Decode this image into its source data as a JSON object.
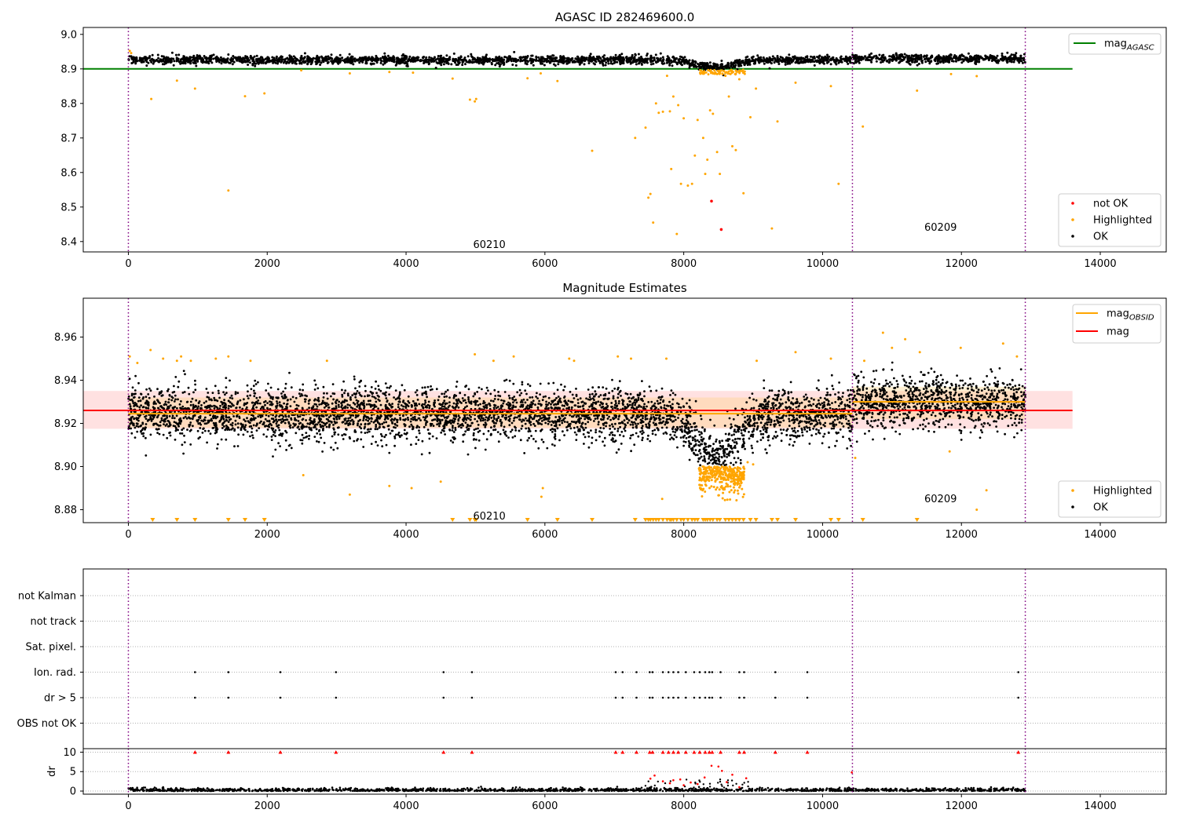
{
  "chart_data": [
    {
      "type": "scatter",
      "title": "AGASC ID 282469600.0",
      "xlim": [
        -650,
        14950
      ],
      "ylim": [
        8.37,
        9.02
      ],
      "x_ticks": [
        0,
        2000,
        4000,
        6000,
        8000,
        10000,
        12000,
        14000
      ],
      "y_ticks": [
        8.4,
        8.5,
        8.6,
        8.7,
        8.8,
        8.9,
        9.0
      ],
      "y_decimals": 1,
      "obsid_boundaries": [
        0,
        10430,
        12920
      ],
      "obsid_labels": [
        {
          "text": "60210",
          "x": 5200,
          "y": 8.39
        },
        {
          "text": "60209",
          "x": 11700,
          "y": 8.44
        }
      ],
      "hlines": [
        {
          "name": "mag_AGASC",
          "y": 8.9,
          "x0": -650,
          "x1": 13600,
          "color": "#008000"
        }
      ],
      "series_summary": {
        "OK": {
          "color": "#000000",
          "base_level": 8.926,
          "dip_center": 8450,
          "dip_depth": 0.021
        },
        "Highlighted": {
          "color": "#FFA500"
        },
        "not OK": {
          "color": "#FF0000"
        }
      },
      "highlighted_points": [
        [
          20,
          8.952
        ],
        [
          40,
          8.946
        ],
        [
          330,
          8.813
        ],
        [
          700,
          8.866
        ],
        [
          960,
          8.843
        ],
        [
          1440,
          8.548
        ],
        [
          1680,
          8.821
        ],
        [
          1960,
          8.829
        ],
        [
          2490,
          8.896
        ],
        [
          3190,
          8.887
        ],
        [
          3760,
          8.891
        ],
        [
          4100,
          8.889
        ],
        [
          4670,
          8.872
        ],
        [
          4920,
          8.811
        ],
        [
          4990,
          8.806
        ],
        [
          5010,
          8.813
        ],
        [
          5750,
          8.873
        ],
        [
          5940,
          8.887
        ],
        [
          6180,
          8.865
        ],
        [
          6680,
          8.663
        ],
        [
          7300,
          8.7
        ],
        [
          7450,
          8.73
        ],
        [
          7490,
          8.527
        ],
        [
          7520,
          8.538
        ],
        [
          7560,
          8.455
        ],
        [
          7600,
          8.8
        ],
        [
          7640,
          8.773
        ],
        [
          7700,
          8.776
        ],
        [
          7760,
          8.88
        ],
        [
          7800,
          8.777
        ],
        [
          7820,
          8.61
        ],
        [
          7850,
          8.82
        ],
        [
          7900,
          8.422
        ],
        [
          7920,
          8.795
        ],
        [
          7960,
          8.567
        ],
        [
          8000,
          8.757
        ],
        [
          8060,
          8.562
        ],
        [
          8120,
          8.567
        ],
        [
          8160,
          8.649
        ],
        [
          8200,
          8.752
        ],
        [
          8240,
          8.886
        ],
        [
          8280,
          8.7
        ],
        [
          8310,
          8.596
        ],
        [
          8340,
          8.637
        ],
        [
          8380,
          8.78
        ],
        [
          8420,
          8.77
        ],
        [
          8480,
          8.659
        ],
        [
          8520,
          8.596
        ],
        [
          8560,
          8.885
        ],
        [
          8600,
          8.88
        ],
        [
          8650,
          8.82
        ],
        [
          8700,
          8.676
        ],
        [
          8750,
          8.665
        ],
        [
          8800,
          8.87
        ],
        [
          8860,
          8.54
        ],
        [
          8960,
          8.76
        ],
        [
          9040,
          8.843
        ],
        [
          9270,
          8.438
        ],
        [
          9350,
          8.748
        ],
        [
          9610,
          8.86
        ],
        [
          10120,
          8.85
        ],
        [
          10230,
          8.567
        ],
        [
          10580,
          8.733
        ],
        [
          11360,
          8.837
        ],
        [
          11850,
          8.885
        ],
        [
          12220,
          8.879
        ]
      ],
      "not_ok_points": [
        [
          8400,
          8.517
        ],
        [
          8540,
          8.435
        ]
      ],
      "legend": [
        {
          "label": "mag_AGASC",
          "kind": "line",
          "color": "#008000",
          "position": "top-right"
        },
        {
          "label": "not OK",
          "kind": "dot",
          "color": "#FF0000",
          "position": "bottom-right"
        },
        {
          "label": "Highlighted",
          "kind": "dot",
          "color": "#FFA500",
          "position": "bottom-right"
        },
        {
          "label": "OK",
          "kind": "dot",
          "color": "#000000",
          "position": "bottom-right"
        }
      ]
    },
    {
      "type": "scatter",
      "title": "Magnitude Estimates",
      "xlim": [
        -650,
        14950
      ],
      "ylim": [
        8.874,
        8.978
      ],
      "x_ticks": [
        0,
        2000,
        4000,
        6000,
        8000,
        10000,
        12000,
        14000
      ],
      "y_ticks": [
        8.88,
        8.9,
        8.92,
        8.94,
        8.96
      ],
      "y_decimals": 2,
      "obsid_boundaries": [
        0,
        10430,
        12920
      ],
      "obsid_labels": [
        {
          "text": "60210",
          "x": 5200,
          "y": 8.877
        },
        {
          "text": "60209",
          "x": 11700,
          "y": 8.885
        }
      ],
      "band": {
        "y0": 8.9175,
        "y1": 8.935,
        "x0": -650,
        "x1": 13600,
        "color": "#FFAAAA"
      },
      "obsid_bands": [
        {
          "x0": 0,
          "x1": 10430,
          "y0": 8.918,
          "y1": 8.932,
          "color": "#FFD27F"
        },
        {
          "x0": 10430,
          "x1": 12920,
          "y0": 8.922,
          "y1": 8.937,
          "color": "#FFD27F"
        }
      ],
      "hlines": [
        {
          "name": "mag",
          "y": 8.926,
          "x0": -650,
          "x1": 13600,
          "color": "#FF0000"
        },
        {
          "name": "mag_OBSID 60210",
          "y": 8.9245,
          "x0": 0,
          "x1": 10430,
          "color": "#FFA500"
        },
        {
          "name": "mag_OBSID 60209",
          "y": 8.93,
          "x0": 10430,
          "x1": 12920,
          "color": "#FFA500"
        }
      ],
      "ok_model": {
        "base_level": 8.926,
        "sigma": 0.006,
        "dip_center": 8450,
        "dip_depth": 0.021
      },
      "highlighted_points": [
        [
          20,
          8.951
        ],
        [
          130,
          8.948
        ],
        [
          320,
          8.954
        ],
        [
          500,
          8.95
        ],
        [
          700,
          8.949
        ],
        [
          760,
          8.951
        ],
        [
          900,
          8.949
        ],
        [
          1260,
          8.95
        ],
        [
          1440,
          8.951
        ],
        [
          1760,
          8.949
        ],
        [
          2520,
          8.896
        ],
        [
          2860,
          8.949
        ],
        [
          3190,
          8.887
        ],
        [
          3760,
          8.891
        ],
        [
          4080,
          8.89
        ],
        [
          4500,
          8.893
        ],
        [
          4990,
          8.952
        ],
        [
          5260,
          8.949
        ],
        [
          5550,
          8.951
        ],
        [
          5950,
          8.886
        ],
        [
          5970,
          8.89
        ],
        [
          6350,
          8.95
        ],
        [
          6420,
          8.949
        ],
        [
          7050,
          8.951
        ],
        [
          7240,
          8.95
        ],
        [
          7690,
          8.885
        ],
        [
          7750,
          8.95
        ],
        [
          8920,
          8.902
        ],
        [
          9000,
          8.901
        ],
        [
          9050,
          8.949
        ],
        [
          9610,
          8.953
        ],
        [
          10120,
          8.95
        ],
        [
          10470,
          8.904
        ],
        [
          10600,
          8.949
        ],
        [
          10870,
          8.962
        ],
        [
          11000,
          8.955
        ],
        [
          11190,
          8.959
        ],
        [
          11400,
          8.953
        ],
        [
          11830,
          8.907
        ],
        [
          11990,
          8.955
        ],
        [
          12220,
          8.88
        ],
        [
          12360,
          8.889
        ],
        [
          12600,
          8.957
        ],
        [
          12800,
          8.951
        ]
      ],
      "clipped_low_x": [
        350,
        700,
        960,
        1440,
        1680,
        1960,
        4670,
        4920,
        4990,
        5010,
        5750,
        6180,
        6680,
        7300,
        7450,
        7490,
        7520,
        7560,
        7600,
        7640,
        7700,
        7760,
        7800,
        7820,
        7850,
        7900,
        7960,
        8000,
        8060,
        8120,
        8160,
        8200,
        8280,
        8310,
        8340,
        8380,
        8420,
        8480,
        8520,
        8600,
        8650,
        8700,
        8750,
        8800,
        8860,
        8960,
        9040,
        9270,
        9350,
        9610,
        10120,
        10230,
        10580,
        11360
      ],
      "legend": [
        {
          "label": "mag_OBSID",
          "kind": "line",
          "color": "#FFA500",
          "position": "top-right"
        },
        {
          "label": "mag",
          "kind": "line",
          "color": "#FF0000",
          "position": "top-right"
        },
        {
          "label": "Highlighted",
          "kind": "dot",
          "color": "#FFA500",
          "position": "bottom-right"
        },
        {
          "label": "OK",
          "kind": "dot",
          "color": "#000000",
          "position": "bottom-right"
        }
      ]
    },
    {
      "type": "scatter",
      "title": "",
      "xlim": [
        -650,
        14950
      ],
      "flag_categories": [
        "OBS not OK",
        "dr > 5",
        "Ion. rad.",
        "Sat. pixel.",
        "not track",
        "not Kalman"
      ],
      "flag_points": {
        "Ion. rad.": [
          960,
          1440,
          2190,
          2990,
          4540,
          4950,
          7020,
          7120,
          7320,
          7510,
          7550,
          7700,
          7780,
          7850,
          7920,
          8030,
          8150,
          8230,
          8310,
          8370,
          8410,
          8530,
          8800,
          8870,
          9320,
          9780,
          12820
        ],
        "dr > 5": [
          960,
          1440,
          2190,
          2990,
          4540,
          4950,
          7020,
          7120,
          7320,
          7510,
          7550,
          7700,
          7780,
          7850,
          7920,
          8030,
          8150,
          8230,
          8310,
          8370,
          8410,
          8530,
          8800,
          8870,
          9320,
          9780,
          12820
        ]
      },
      "obsid_boundaries": [
        0,
        10430,
        12920
      ]
    },
    {
      "type": "scatter",
      "title": "",
      "ylabel": "dr",
      "xlim": [
        -650,
        14950
      ],
      "ylim": [
        -0.8,
        10.9
      ],
      "x_ticks": [
        0,
        2000,
        4000,
        6000,
        8000,
        10000,
        12000,
        14000
      ],
      "y_ticks": [
        0,
        5,
        10
      ],
      "clip_value": 10,
      "clipped_x": [
        960,
        1440,
        2190,
        2990,
        4540,
        4950,
        7020,
        7120,
        7320,
        7510,
        7550,
        7700,
        7780,
        7850,
        7920,
        8030,
        8150,
        8230,
        8310,
        8370,
        8410,
        8530,
        8800,
        8870,
        9320,
        9780,
        12820
      ],
      "red_points": [
        [
          7520,
          3.2
        ],
        [
          7580,
          4.0
        ],
        [
          7700,
          2.5
        ],
        [
          7800,
          2.0
        ],
        [
          7850,
          2.8
        ],
        [
          7950,
          3.0
        ],
        [
          8000,
          1.5
        ],
        [
          8100,
          2.2
        ],
        [
          8200,
          1.8
        ],
        [
          8300,
          3.5
        ],
        [
          8400,
          6.5
        ],
        [
          8500,
          6.3
        ],
        [
          8550,
          5.2
        ],
        [
          8620,
          2.3
        ],
        [
          8700,
          4.2
        ],
        [
          8800,
          1.0
        ],
        [
          8900,
          3.3
        ],
        [
          10420,
          4.8
        ]
      ],
      "obsid_boundaries": [
        0,
        10430,
        12920
      ]
    }
  ]
}
